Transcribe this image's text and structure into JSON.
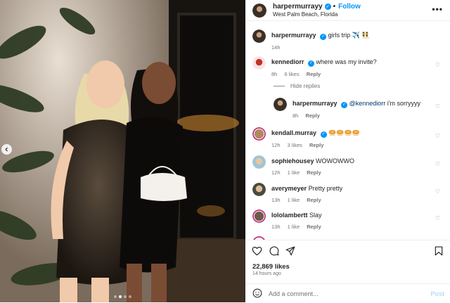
{
  "post": {
    "author": "harpermurrayy",
    "location": "West Palm Beach, Florida",
    "follow_label": "Follow",
    "more_label": "•••",
    "caption_user": "harpermurrayy",
    "caption_text": "girls trip ✈️ 👯",
    "caption_time": "14h",
    "likes": "22,869 likes",
    "time_ago": "14 hours ago",
    "add_comment_placeholder": "Add a comment...",
    "post_label": "Post",
    "carousel_dots": 4,
    "active_dot": 1
  },
  "comments": [
    {
      "user": "kennediorr",
      "verified": true,
      "text": "where was my invite?",
      "time": "8h",
      "likes": "6 likes",
      "reply": "Reply"
    },
    {
      "user": "harpermurrayy",
      "verified": true,
      "mention": "@kennediorr",
      "text": " i'm sorryyyy",
      "time": "8h",
      "likes": "",
      "reply": "Reply"
    },
    {
      "user": "kendall.murray",
      "verified": true,
      "text": "🥯🥯🥯🥯",
      "time": "12h",
      "likes": "3 likes",
      "reply": "Reply"
    },
    {
      "user": "sophiehousey",
      "verified": false,
      "text": "WOWOWWO",
      "time": "12h",
      "likes": "1 like",
      "reply": "Reply"
    },
    {
      "user": "averymeyer",
      "verified": false,
      "text": "Pretty pretty",
      "time": "13h",
      "likes": "1 like",
      "reply": "Reply"
    },
    {
      "user": "lololambertt",
      "verified": false,
      "text": "Slay",
      "time": "13h",
      "likes": "1 like",
      "reply": "Reply"
    }
  ],
  "hide_replies": "Hide replies",
  "colors": {
    "accent": "#0095f6",
    "text": "#262626",
    "muted": "#737373"
  }
}
